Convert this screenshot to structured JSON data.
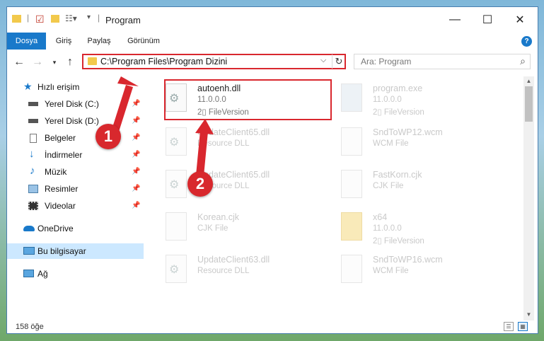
{
  "window": {
    "title": "Program",
    "controls": {
      "minimize": "—",
      "maximize": "☐",
      "close": "✕"
    }
  },
  "ribbon": {
    "tabs": [
      "Dosya",
      "Giriş",
      "Paylaş",
      "Görünüm"
    ],
    "help": "?"
  },
  "address": {
    "path": "C:\\Program Files\\Program Dizini",
    "search_placeholder": "Ara: Program"
  },
  "sidebar": {
    "items": [
      {
        "label": "Hızlı erişim",
        "icon": "star-icon"
      },
      {
        "label": "Yerel Disk (C:)",
        "icon": "drive-icon",
        "pinned": true
      },
      {
        "label": "Yerel Disk (D:)",
        "icon": "drive-icon",
        "pinned": true
      },
      {
        "label": "Belgeler",
        "icon": "documents-icon",
        "pinned": true
      },
      {
        "label": "İndirmeler",
        "icon": "download-icon",
        "pinned": true
      },
      {
        "label": "Müzik",
        "icon": "music-icon",
        "pinned": true
      },
      {
        "label": "Resimler",
        "icon": "pictures-icon",
        "pinned": true
      },
      {
        "label": "Videolar",
        "icon": "videos-icon",
        "pinned": true
      },
      {
        "label": "OneDrive",
        "icon": "cloud-icon"
      },
      {
        "label": "Bu bilgisayar",
        "icon": "computer-icon",
        "selected": true
      },
      {
        "label": "Ağ",
        "icon": "network-icon"
      }
    ]
  },
  "files": [
    {
      "name": "autoenh.dll",
      "sub1": "11.0.0.0",
      "sub2": "2▯ FileVersion",
      "icon": "dll-file-icon",
      "highlighted": true
    },
    {
      "name": "program.exe",
      "sub1": "11.0.0.0",
      "sub2": "2▯ FileVersion",
      "icon": "exe-file-icon"
    },
    {
      "name": "UpdateClient65.dll",
      "sub1": "Resource DLL",
      "icon": "dll-file-icon"
    },
    {
      "name": "SndToWP12.wcm",
      "sub1": "WCM File",
      "icon": "blank-file-icon"
    },
    {
      "name": "UpdateClient65.dll",
      "sub1": "Resource DLL",
      "icon": "dll-file-icon"
    },
    {
      "name": "FastKorn.cjk",
      "sub1": "CJK File",
      "icon": "blank-file-icon"
    },
    {
      "name": "Korean.cjk",
      "sub1": "CJK File",
      "icon": "blank-file-icon"
    },
    {
      "name": "x64",
      "sub1": "11.0.0.0",
      "sub2": "2▯ FileVersion",
      "icon": "folder-icon"
    },
    {
      "name": "UpdateClient63.dll",
      "sub1": "Resource DLL",
      "icon": "dll-file-icon"
    },
    {
      "name": "SndToWP16.wcm",
      "sub1": "WCM File",
      "icon": "blank-file-icon"
    }
  ],
  "status": {
    "count": "158 öğe"
  },
  "annotations": {
    "badge1": "1",
    "badge2": "2"
  },
  "colors": {
    "accent": "#1979ca",
    "highlight": "#d9272e",
    "selected": "#cce8ff"
  }
}
